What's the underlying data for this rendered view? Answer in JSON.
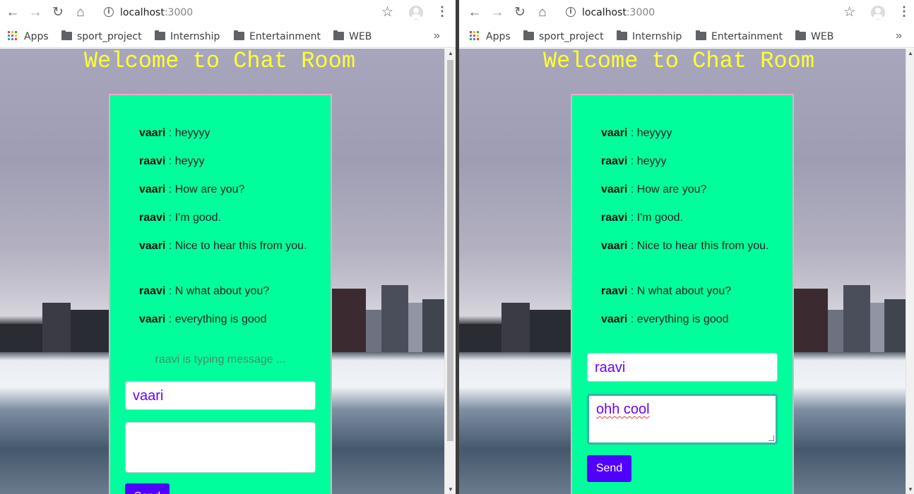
{
  "browser": {
    "url_host": "localhost",
    "url_port": ":3000",
    "bookmarks": [
      "Apps",
      "sport_project",
      "Internship",
      "Entertainment",
      "WEB"
    ],
    "overflow_chevron": "»"
  },
  "app": {
    "title": "Welcome to Chat Room",
    "send_label": "Send"
  },
  "left": {
    "messages": [
      {
        "user": "vaari",
        "text": " : heyyyy"
      },
      {
        "user": "raavi",
        "text": " : heyyy"
      },
      {
        "user": "vaari",
        "text": " : How are you?"
      },
      {
        "user": "raavi",
        "text": " : I'm good."
      },
      {
        "user": "vaari",
        "text": " : Nice to hear this from you."
      },
      {
        "user": "raavi",
        "text": " : N what about you?"
      },
      {
        "user": "vaari",
        "text": " : everything is good"
      }
    ],
    "typing_status": "raavi is typing message ...",
    "name_value": "vaari",
    "message_value": ""
  },
  "right": {
    "messages": [
      {
        "user": "vaari",
        "text": " : heyyyy"
      },
      {
        "user": "raavi",
        "text": " : heyyy"
      },
      {
        "user": "vaari",
        "text": " : How are you?"
      },
      {
        "user": "raavi",
        "text": " : I'm good."
      },
      {
        "user": "vaari",
        "text": " : Nice to hear this from you."
      },
      {
        "user": "raavi",
        "text": " : N what about you?"
      },
      {
        "user": "vaari",
        "text": " : everything is good"
      }
    ],
    "name_value": "raavi",
    "message_value": "ohh cool"
  },
  "colors": {
    "chat_bg": "#00ff9c",
    "title_color": "#ffff33",
    "send_button": "#5000ff",
    "input_text": "#6a00ff"
  }
}
